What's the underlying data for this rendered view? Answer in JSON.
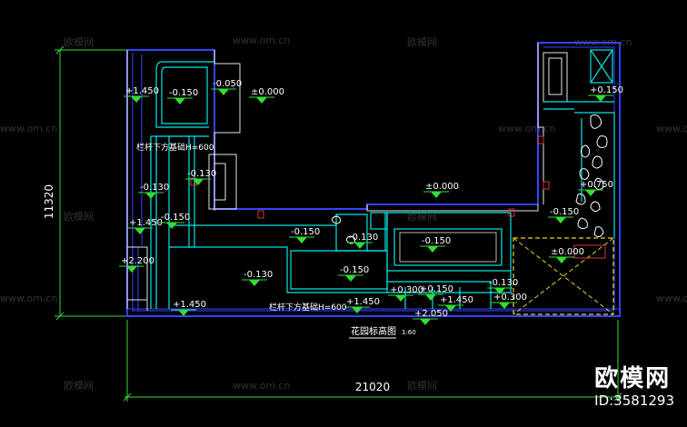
{
  "title": "花园标高图",
  "scale": "1:60",
  "dimensions": {
    "height_dim": "11320",
    "width_dim": "21020"
  },
  "levels": [
    "+1.450",
    "-0.150",
    "-0.050",
    "±0.000",
    "+0.150",
    "-0.130",
    "+1.450",
    "-0.150",
    "+2.200",
    "±0.000",
    "-0.150",
    "-0.130",
    "-0.150",
    "+0.750",
    "-0.150",
    "±0.000",
    "-0.130",
    "-0.150",
    "+0.300",
    "+0.150",
    "+1.450",
    "-0.130",
    "+0.300",
    "+2.050",
    "+1.450",
    "+1.450",
    "-0.130"
  ],
  "notes": {
    "rail_base_left": "栏杆下方基础H=600",
    "rail_base_bottom": "栏杆下方基础H=600"
  },
  "watermarks": {
    "site_a": "欧模网",
    "site_b": "www.om.cn"
  },
  "brand": {
    "name": "欧模网",
    "id": "ID:3581293"
  },
  "colors": {
    "background": "#000000",
    "wall_blue": "#3344ff",
    "outline_white": "#ffffff",
    "cyan": "#00e5e5",
    "green": "#33dd33",
    "red": "#dd3344",
    "yellow": "#e8d21a"
  }
}
